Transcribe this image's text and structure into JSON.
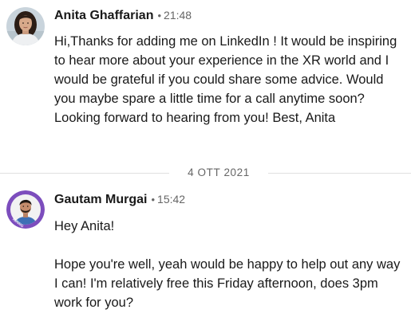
{
  "messages": [
    {
      "sender": "Anita Ghaffarian",
      "separator": "•",
      "time": "21:48",
      "avatar_icon": "profile-photo-woman",
      "paragraphs": [
        "Hi,Thanks for adding me on LinkedIn ! It would be inspiring to hear more about your experience in the XR world and I would be grateful if you could share some advice. Would you maybe spare a little time for a call anytime soon? Looking forward to hearing from you! Best, Anita"
      ]
    },
    {
      "sender": "Gautam Murgai",
      "separator": "•",
      "time": "15:42",
      "avatar_icon": "profile-photo-man-hiring-frame",
      "avatar_badge": "HIRING",
      "paragraphs": [
        "Hey Anita!",
        "Hope you're well, yeah would be happy to help out any way I can! I'm relatively free this Friday afternoon, does 3pm work for you?"
      ]
    }
  ],
  "date_divider": "4 OTT 2021",
  "colors": {
    "text": "#191919",
    "meta": "#666666",
    "divider": "#e0e0e0",
    "hiring_frame": "#7c4dbd"
  }
}
